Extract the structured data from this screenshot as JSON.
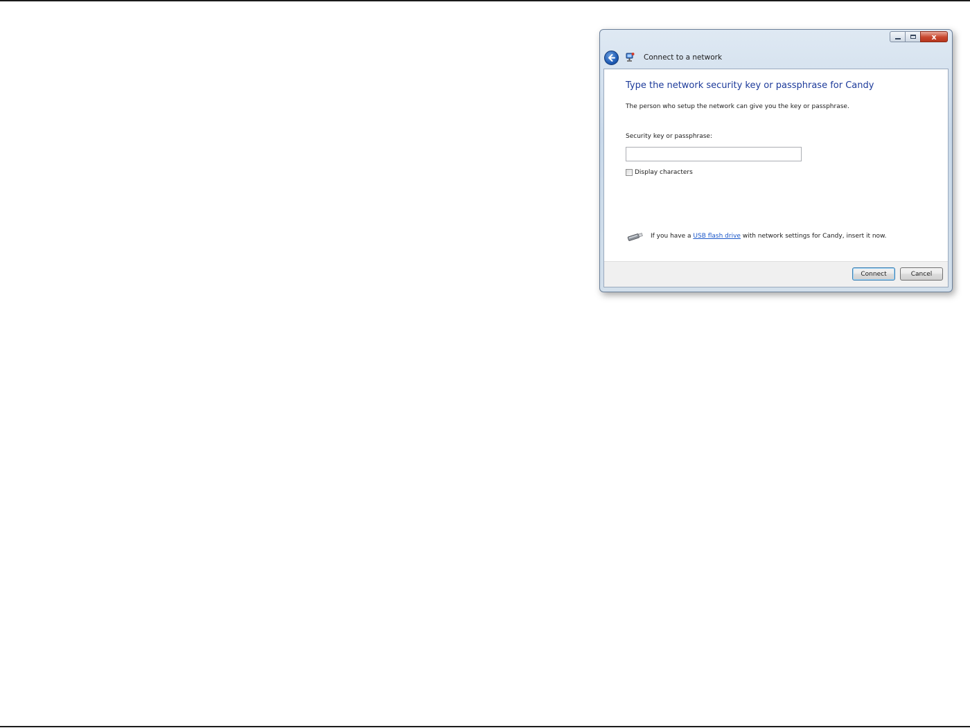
{
  "window": {
    "title": "Connect to a network",
    "caption_buttons": {
      "close_glyph": "x"
    }
  },
  "dialog": {
    "heading": "Type the network security key or passphrase for Candy",
    "description": "The person who setup the network can give you the key or passphrase.",
    "key_field": {
      "label": "Security key or passphrase:",
      "value": "",
      "placeholder": ""
    },
    "display_characters": {
      "label": "Display characters",
      "checked": false
    },
    "usb_notice": {
      "prefix": "If you have a ",
      "link": "USB flash drive",
      "suffix": " with network settings for Candy, insert it now."
    }
  },
  "footer": {
    "connect_label": "Connect",
    "cancel_label": "Cancel"
  },
  "colors": {
    "heading": "#1c3a9a",
    "link": "#1a57c9",
    "close_button": "#c8472e"
  },
  "icons": {
    "back": "back-arrow-icon",
    "network": "network-icon",
    "usb": "usb-drive-icon"
  }
}
